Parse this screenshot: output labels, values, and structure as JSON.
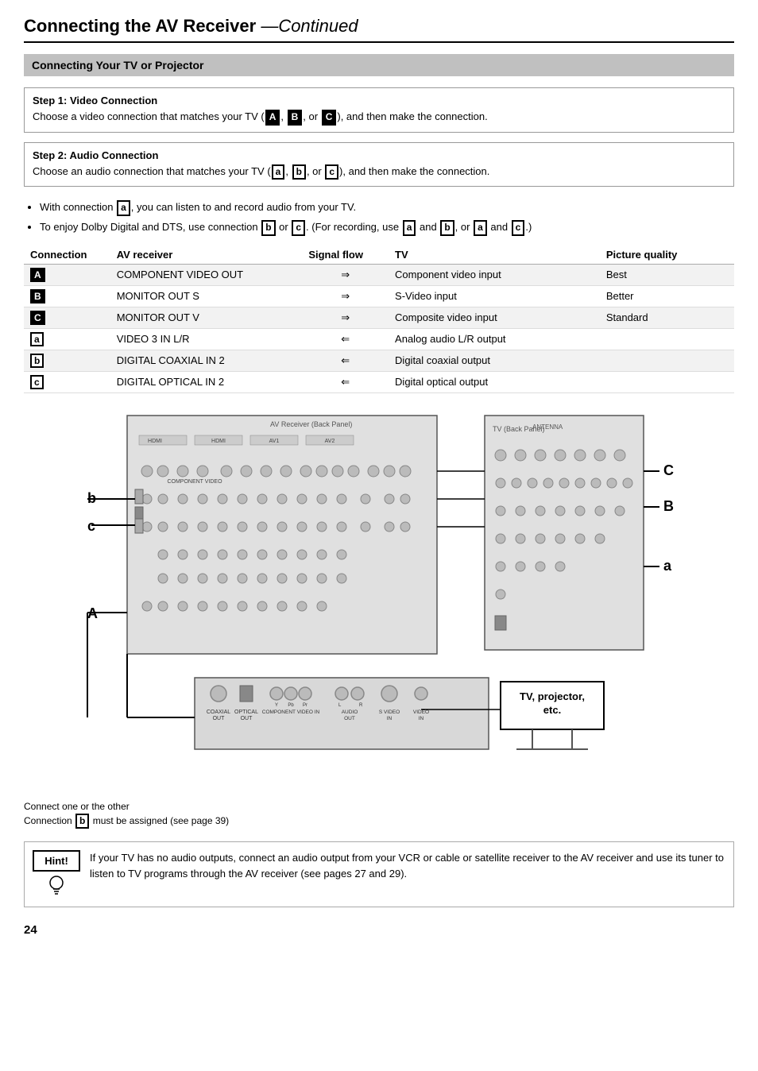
{
  "page": {
    "title": "Connecting the AV Receiver",
    "title_suffix": "—Continued",
    "page_number": "24"
  },
  "section_main": {
    "title": "Connecting Your TV or Projector"
  },
  "step1": {
    "heading": "Step 1: Video Connection",
    "text": "Choose a video connection that matches your TV (",
    "badges": [
      "A",
      "B",
      "C"
    ],
    "text2": "), and then make the connection."
  },
  "step2": {
    "heading": "Step 2: Audio Connection",
    "text": "Choose an audio connection that matches your TV (",
    "badges": [
      "a",
      "b",
      "c"
    ],
    "text2": "), and then make the connection."
  },
  "bullets": [
    "With connection a, you can listen to and record audio from your TV.",
    "To enjoy Dolby Digital and DTS, use connection b or c. (For recording, use a and b, or a and c.)"
  ],
  "table": {
    "headers": [
      "Connection",
      "AV receiver",
      "Signal flow",
      "TV",
      "Picture quality"
    ],
    "rows": [
      {
        "conn": "A",
        "conn_filled": true,
        "av": "COMPONENT VIDEO OUT",
        "flow": "⇒",
        "tv": "Component video input",
        "pq": "Best"
      },
      {
        "conn": "B",
        "conn_filled": true,
        "av": "MONITOR OUT S",
        "flow": "⇒",
        "tv": "S-Video input",
        "pq": "Better"
      },
      {
        "conn": "C",
        "conn_filled": true,
        "av": "MONITOR OUT V",
        "flow": "⇒",
        "tv": "Composite video input",
        "pq": "Standard"
      },
      {
        "conn": "a",
        "conn_filled": false,
        "av": "VIDEO 3 IN L/R",
        "flow": "⇐",
        "tv": "Analog audio L/R output",
        "pq": ""
      },
      {
        "conn": "b",
        "conn_filled": false,
        "av": "DIGITAL COAXIAL IN 2",
        "flow": "⇐",
        "tv": "Digital coaxial output",
        "pq": ""
      },
      {
        "conn": "c",
        "conn_filled": false,
        "av": "DIGITAL OPTICAL IN 2",
        "flow": "⇐",
        "tv": "Digital optical output",
        "pq": ""
      }
    ]
  },
  "diagram": {
    "labels_left": [
      "b",
      "c",
      "A"
    ],
    "labels_right": [
      "C",
      "B",
      "a"
    ],
    "connect_note_line1": "Connect one or the other",
    "connect_note_line2": "Connection b must be assigned (see page 39)",
    "tv_box_text": "TV, projector, etc.",
    "bottom_labels": [
      "COAXIAL OUT",
      "OPTICAL OUT",
      "Y  Pb  Pr COMPONENT VIDEO IN",
      "L R AUDIO OUT",
      "S VIDEO IN",
      "VIDEO IN"
    ]
  },
  "hint": {
    "label": "Hint!",
    "text": "If your TV has no audio outputs, connect an audio output from your VCR or cable or satellite receiver to the AV receiver and use its tuner to listen to TV programs through the AV receiver (see pages 27 and 29)."
  }
}
